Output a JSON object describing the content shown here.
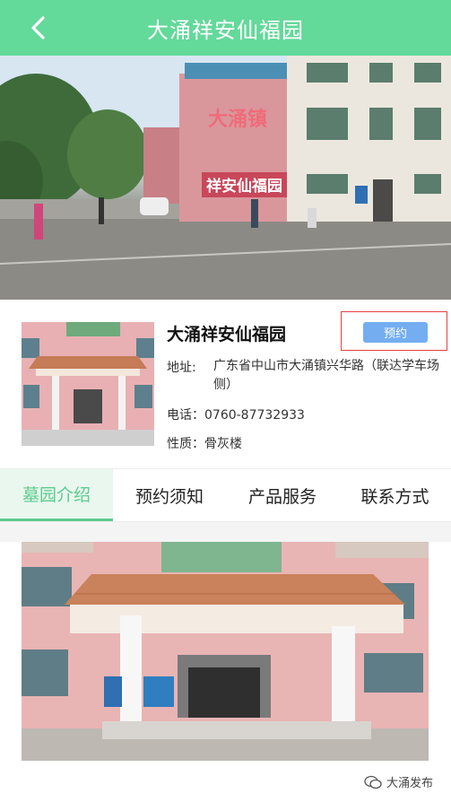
{
  "header": {
    "title": "大涌祥安仙福园",
    "back_icon": "chevron-left-icon"
  },
  "hero": {
    "sign_top": "大涌镇",
    "sign_bottom": "祥安仙福园"
  },
  "cemetery": {
    "name": "大涌祥安仙福园",
    "book_label": "预约",
    "address_label": "地址:",
    "address_value": "广东省中山市大涌镇兴华路（联达学车场侧）",
    "phone_line": "电话：0760-87732933",
    "type_line": "性质：骨灰楼"
  },
  "tabs": [
    {
      "label": "墓园介绍",
      "active": true
    },
    {
      "label": "预约须知",
      "active": false
    },
    {
      "label": "产品服务",
      "active": false
    },
    {
      "label": "联系方式",
      "active": false
    }
  ],
  "watermark": {
    "text": "大涌发布",
    "icon": "wechat-icon"
  },
  "colors": {
    "header": "#63d99a",
    "accent": "#5ccb8d",
    "book_button": "#74aef0",
    "highlight_frame": "#e44040"
  }
}
